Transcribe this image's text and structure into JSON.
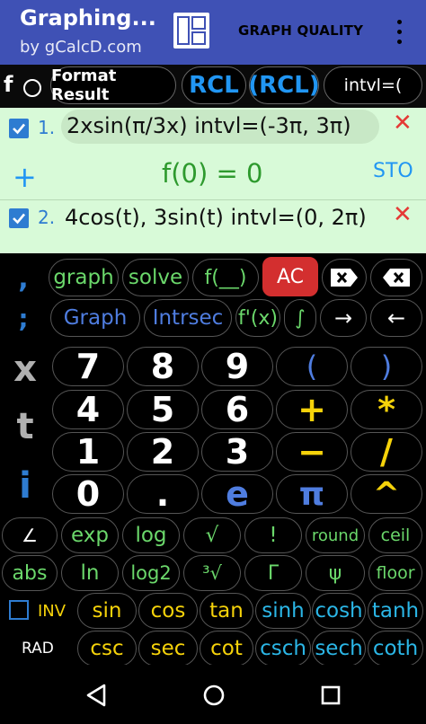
{
  "appbar": {
    "title": "Graphing...",
    "subtitle": "by gCalcD.com",
    "graph_quality": "GRAPH QUALITY"
  },
  "toolbar": {
    "f_label": "f",
    "format_result": "Format Result",
    "rcl": "RCL",
    "rcl_paren": "(RCL)",
    "intvl": "intvl=("
  },
  "expressions": {
    "e1_num": "1.",
    "e1_text": "2xsin(π/3x)   intvl=(-3π, 3π)",
    "result_plus": "+",
    "result": "f(0) = 0",
    "sto": "STO",
    "e2_num": "2.",
    "e2_text": "4cos(t), 3sin(t)   intvl=(0, 2π)",
    "close": "✕"
  },
  "keys": {
    "comma": ",",
    "graph": "graph",
    "solve": "solve",
    "f_blank": "f(__)",
    "ac": "AC",
    "semicolon": ";",
    "graph_btn": "Graph",
    "intrsec": "Intrsec",
    "fprime": "f'(x)",
    "integral": "∫",
    "arrow_right": "→",
    "arrow_left": "←",
    "x": "x",
    "t": "t",
    "i": "i",
    "d7": "7",
    "d8": "8",
    "d9": "9",
    "lparen": "(",
    "rparen": ")",
    "d4": "4",
    "d5": "5",
    "d6": "6",
    "plus": "+",
    "times": "*",
    "d1": "1",
    "d2": "2",
    "d3": "3",
    "minus": "−",
    "divide": "/",
    "d0": "0",
    "dot": ".",
    "e": "e",
    "pi": "π",
    "caret": "^",
    "angle": "∠",
    "exp": "exp",
    "log": "log",
    "sqrt": "√",
    "fact": "!",
    "round": "round",
    "ceil": "ceil",
    "abs": "abs",
    "ln": "ln",
    "log2": "log2",
    "cbrt": "³√",
    "gamma": "Γ",
    "psi": "ψ",
    "floor": "floor",
    "inv": "INV",
    "sin": "sin",
    "cos": "cos",
    "tan": "tan",
    "sinh": "sinh",
    "cosh": "cosh",
    "tanh": "tanh",
    "rad": "RAD",
    "csc": "csc",
    "sec": "sec",
    "cot": "cot",
    "csch": "csch",
    "sech": "sech",
    "coth": "coth"
  },
  "colors": {
    "appbar": "#3f51b5",
    "toolbar_blue": "#2196f3",
    "panel_bg": "#d8fad8",
    "checkbox_blue": "#2e7cd1",
    "result_green": "#2e9a2e",
    "sto_blue": "#2196f3",
    "close_red": "#e53935",
    "ac_red": "#d32f2f",
    "green_key": "#6bd86b",
    "blue_key": "#4f7de0",
    "digit_white": "#ffffff",
    "yellow_key": "#f5d20a",
    "cyan_key": "#2bb6e6",
    "sidekey_gray": "#b0b0b0",
    "sidekey_blue": "#2e7cd1"
  }
}
